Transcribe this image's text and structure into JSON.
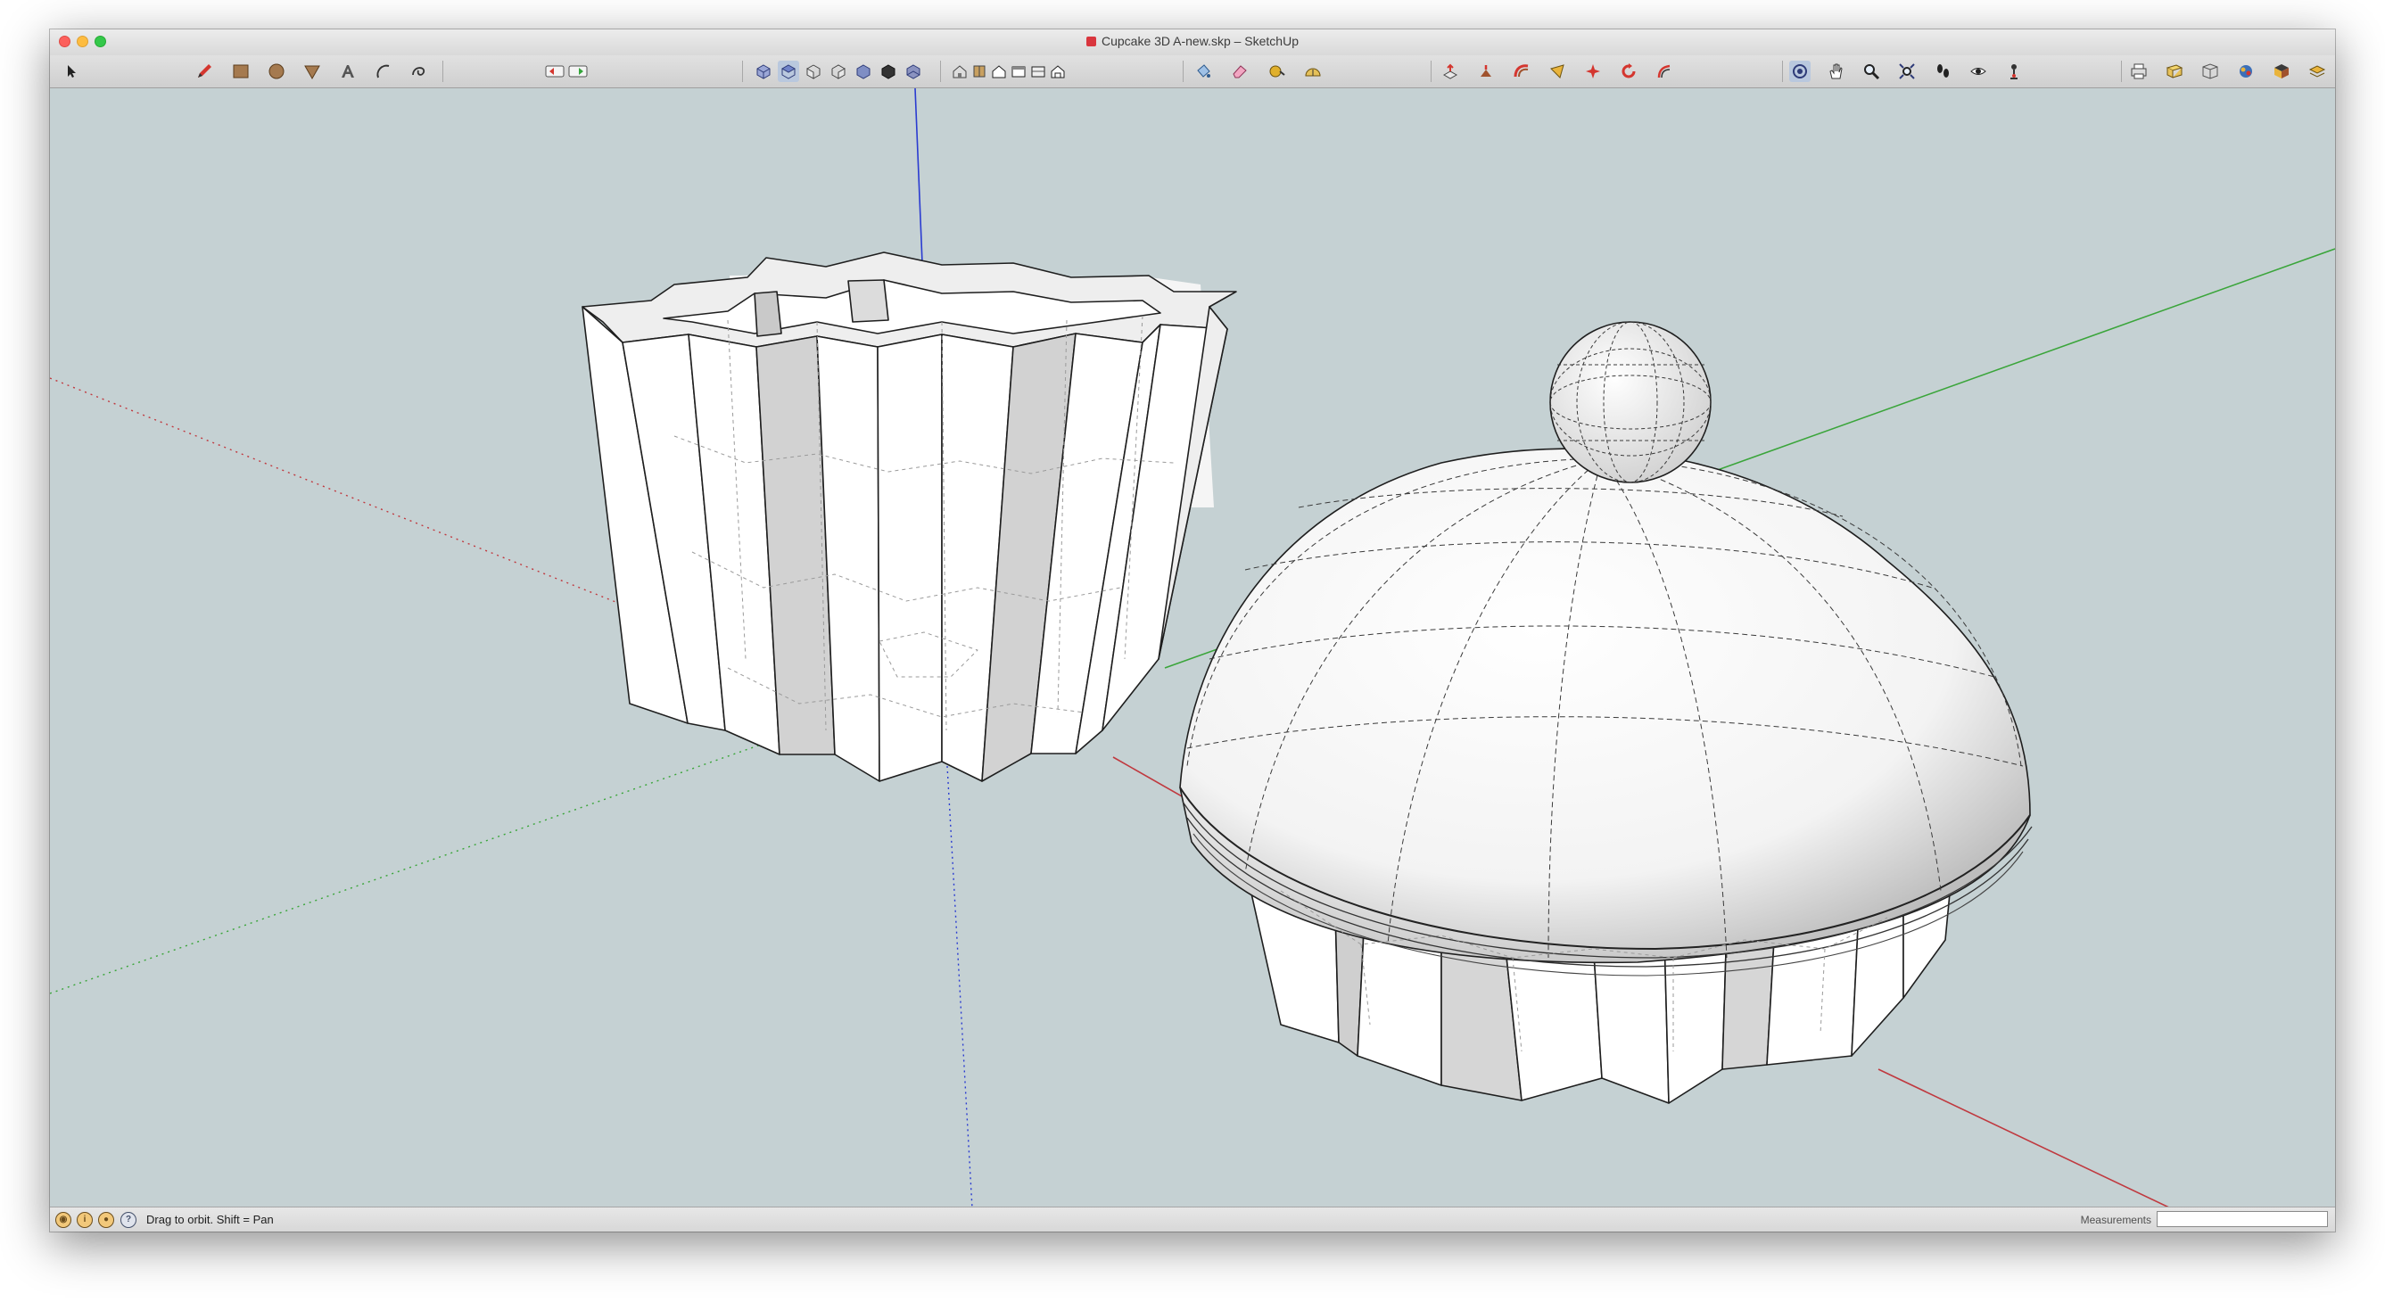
{
  "window": {
    "title": "Cupcake 3D A-new.skp – SketchUp"
  },
  "toolbar": {
    "tools": [
      {
        "name": "select-tool-icon"
      },
      {
        "name": "pencil-tool-icon"
      },
      {
        "name": "rectangle-tool-icon"
      },
      {
        "name": "circle-tool-icon"
      },
      {
        "name": "polygon-tool-icon"
      },
      {
        "name": "text-tool-icon"
      },
      {
        "name": "arc-tool-icon"
      },
      {
        "name": "freehand-tool-icon"
      },
      {
        "name": "undo-icon"
      },
      {
        "name": "redo-icon"
      },
      {
        "name": "iso-view-icon"
      },
      {
        "name": "top-view-icon"
      },
      {
        "name": "front-view-icon"
      },
      {
        "name": "right-view-icon"
      },
      {
        "name": "back-view-icon"
      },
      {
        "name": "left-view-icon"
      },
      {
        "name": "bottom-view-icon"
      },
      {
        "name": "xray-style-icon"
      },
      {
        "name": "wireframe-style-icon"
      },
      {
        "name": "hidden-line-style-icon"
      },
      {
        "name": "shaded-style-icon"
      },
      {
        "name": "shaded-texture-style-icon"
      },
      {
        "name": "monochrome-style-icon"
      },
      {
        "name": "paint-bucket-icon"
      },
      {
        "name": "eraser-icon"
      },
      {
        "name": "tape-measure-icon"
      },
      {
        "name": "protractor-icon"
      },
      {
        "name": "push-pull-icon"
      },
      {
        "name": "follow-me-icon"
      },
      {
        "name": "offset-icon"
      },
      {
        "name": "move-icon"
      },
      {
        "name": "rotate-icon"
      },
      {
        "name": "scale-icon"
      },
      {
        "name": "orbit-icon"
      },
      {
        "name": "pan-icon"
      },
      {
        "name": "zoom-icon"
      },
      {
        "name": "zoom-extents-icon"
      },
      {
        "name": "walk-icon"
      },
      {
        "name": "look-around-icon"
      },
      {
        "name": "position-camera-icon"
      },
      {
        "name": "print-icon"
      },
      {
        "name": "model-info-icon"
      },
      {
        "name": "components-icon"
      },
      {
        "name": "materials-icon"
      },
      {
        "name": "styles-icon"
      },
      {
        "name": "layers-icon"
      },
      {
        "name": "scenes-icon"
      }
    ]
  },
  "status": {
    "hint": "Drag to orbit.  Shift = Pan",
    "measurements_label": "Measurements",
    "measurements_value": ""
  },
  "colors": {
    "viewport_bg": "#c5d1d3",
    "axis_red": "#c0393f",
    "axis_green": "#3aa53a",
    "axis_blue": "#2a3bd1",
    "face_light": "#ffffff",
    "face_shade": "#d6d6d6",
    "edge": "#1e1e1e"
  }
}
